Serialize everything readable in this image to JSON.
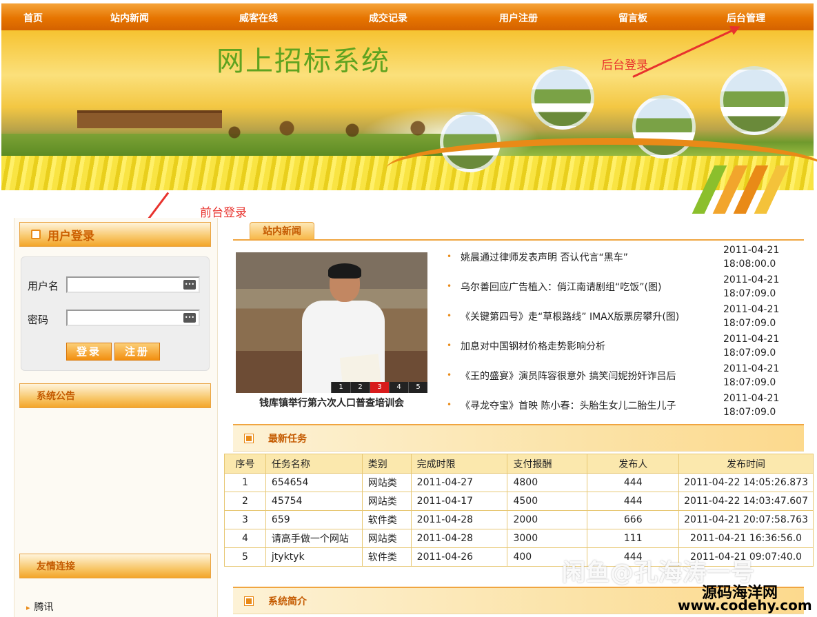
{
  "nav": {
    "items": [
      {
        "label": "首页"
      },
      {
        "label": "站内新闻"
      },
      {
        "label": "威客在线"
      },
      {
        "label": "成交记录"
      },
      {
        "label": "用户注册"
      },
      {
        "label": "留言板"
      },
      {
        "label": "后台管理"
      }
    ]
  },
  "banner": {
    "title": "网上招标系统"
  },
  "annotations": {
    "backend": "后台登录",
    "frontend": "前台登录"
  },
  "login": {
    "title": "用户登录",
    "username_label": "用户名",
    "password_label": "密码",
    "username_value": "",
    "password_value": "",
    "login_button": "登录",
    "register_button": "注册"
  },
  "sidebar": {
    "notice_title": "系统公告",
    "links_title": "友情连接",
    "links": [
      {
        "label": "腾讯"
      }
    ]
  },
  "news": {
    "tab_label": "站内新闻",
    "photo_caption": "钱库镇举行第六次人口普查培训会",
    "pager": [
      "1",
      "2",
      "3",
      "4",
      "5"
    ],
    "pager_active": "3",
    "items": [
      {
        "title": "姚晨通过律师发表声明 否认代言“黑车”",
        "date": "2011-04-21",
        "time": "18:08:00.0"
      },
      {
        "title": "乌尔善回应广告植入：俏江南请剧组“吃饭”(图)",
        "date": "2011-04-21",
        "time": "18:07:09.0"
      },
      {
        "title": "《关键第四号》走“草根路线” IMAX版票房攀升(图)",
        "date": "2011-04-21",
        "time": "18:07:09.0"
      },
      {
        "title": "加息对中国钢材价格走势影响分析",
        "date": "2011-04-21",
        "time": "18:07:09.0"
      },
      {
        "title": "《王的盛宴》演员阵容很意外 搞笑闫妮扮奸诈吕后",
        "date": "2011-04-21",
        "time": "18:07:09.0"
      },
      {
        "title": "《寻龙夺宝》首映 陈小春：头胎生女儿二胎生儿子",
        "date": "2011-04-21",
        "time": "18:07:09.0"
      }
    ]
  },
  "tasks": {
    "title": "最新任务",
    "columns": [
      "序号",
      "任务名称",
      "类别",
      "完成时限",
      "支付报酬",
      "发布人",
      "发布时间"
    ],
    "rows": [
      [
        "1",
        "654654",
        "网站类",
        "2011-04-27",
        "4800",
        "444",
        "2011-04-22 14:05:26.873"
      ],
      [
        "2",
        "45754",
        "网站类",
        "2011-04-17",
        "4500",
        "444",
        "2011-04-22 14:03:47.607"
      ],
      [
        "3",
        "659",
        "软件类",
        "2011-04-28",
        "2000",
        "666",
        "2011-04-21 20:07:58.763"
      ],
      [
        "4",
        "请高手做一个网站",
        "网站类",
        "2011-04-28",
        "3000",
        "111",
        "2011-04-21 16:36:56.0"
      ],
      [
        "5",
        "jtyktyk",
        "软件类",
        "2011-04-26",
        "400",
        "444",
        "2011-04-21 09:07:40.0"
      ]
    ]
  },
  "intro": {
    "title": "系统简介"
  },
  "watermark": {
    "text": "闲鱼@孔海涛一号",
    "brand_cn": "源码海洋网",
    "brand_url": "www.codehy.com"
  },
  "colors": {
    "accent": "#e67400",
    "title_green": "#5fa320",
    "annotation_red": "#e8322d"
  }
}
